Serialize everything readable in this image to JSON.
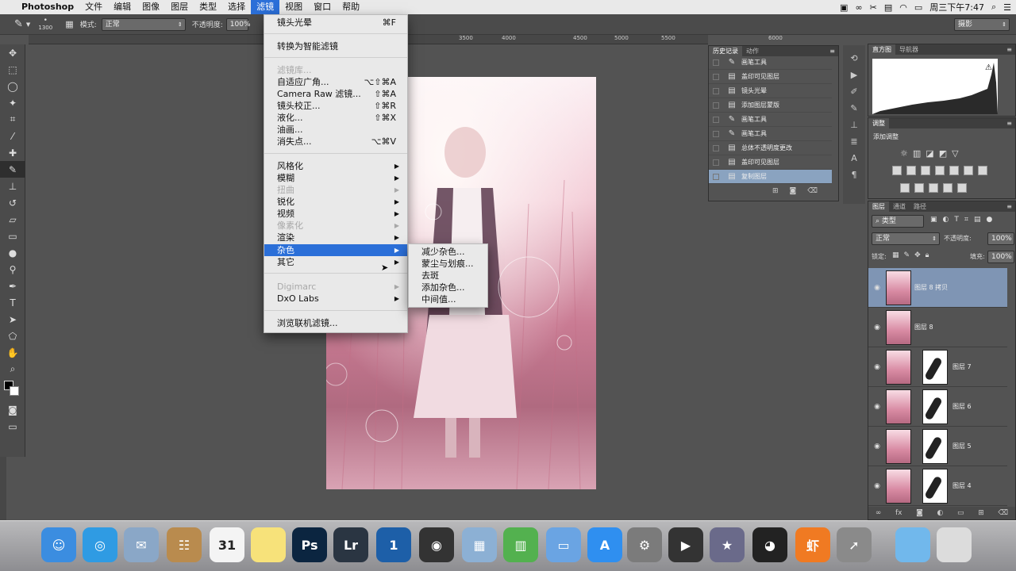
{
  "menubar": {
    "apple": "",
    "items": [
      "Photoshop",
      "文件",
      "编辑",
      "图像",
      "图层",
      "类型",
      "选择",
      "滤镜",
      "视图",
      "窗口",
      "帮助"
    ],
    "active_index": 7,
    "clock": "周三下午7:47"
  },
  "optbar": {
    "brush_size": "1300",
    "mode_label": "模式:",
    "mode_value": "正常",
    "opacity_label": "不透明度:",
    "opacity_value": "100%",
    "workspace": "摄影"
  },
  "ruler": {
    "ticks": [
      "3500",
      "4000",
      "4500",
      "5000",
      "5500",
      "6000"
    ]
  },
  "filter_menu": {
    "items": [
      {
        "label": "镜头光晕",
        "shortcut": "⌘F",
        "disabled": false,
        "submenu": false
      },
      {
        "label": "转换为智能滤镜",
        "shortcut": "",
        "disabled": false,
        "submenu": false
      },
      {
        "label": "滤镜库...",
        "shortcut": "",
        "disabled": true,
        "submenu": false
      },
      {
        "label": "自适应广角...",
        "shortcut": "⌥⇧⌘A",
        "disabled": false,
        "submenu": false
      },
      {
        "label": "Camera Raw 滤镜...",
        "shortcut": "⇧⌘A",
        "disabled": false,
        "submenu": false
      },
      {
        "label": "镜头校正...",
        "shortcut": "⇧⌘R",
        "disabled": false,
        "submenu": false
      },
      {
        "label": "液化...",
        "shortcut": "⇧⌘X",
        "disabled": false,
        "submenu": false
      },
      {
        "label": "油画...",
        "shortcut": "",
        "disabled": false,
        "submenu": false
      },
      {
        "label": "消失点...",
        "shortcut": "⌥⌘V",
        "disabled": false,
        "submenu": false
      },
      {
        "label": "风格化",
        "shortcut": "",
        "disabled": false,
        "submenu": true
      },
      {
        "label": "模糊",
        "shortcut": "",
        "disabled": false,
        "submenu": true
      },
      {
        "label": "扭曲",
        "shortcut": "",
        "disabled": true,
        "submenu": true
      },
      {
        "label": "锐化",
        "shortcut": "",
        "disabled": false,
        "submenu": true
      },
      {
        "label": "视频",
        "shortcut": "",
        "disabled": false,
        "submenu": true
      },
      {
        "label": "像素化",
        "shortcut": "",
        "disabled": true,
        "submenu": true
      },
      {
        "label": "渲染",
        "shortcut": "",
        "disabled": false,
        "submenu": true
      },
      {
        "label": "杂色",
        "shortcut": "",
        "disabled": false,
        "submenu": true,
        "selected": true
      },
      {
        "label": "其它",
        "shortcut": "",
        "disabled": false,
        "submenu": true
      },
      {
        "label": "Digimarc",
        "shortcut": "",
        "disabled": true,
        "submenu": true
      },
      {
        "label": "DxO Labs",
        "shortcut": "",
        "disabled": false,
        "submenu": true
      },
      {
        "label": "浏览联机滤镜...",
        "shortcut": "",
        "disabled": false,
        "submenu": false
      }
    ]
  },
  "noise_submenu": [
    "减少杂色...",
    "蒙尘与划痕...",
    "去斑",
    "添加杂色...",
    "中间值..."
  ],
  "history": {
    "tabs": [
      "历史记录",
      "动作"
    ],
    "items": [
      "画笔工具",
      "盖印可见图层",
      "镜头光晕",
      "添加图层蒙版",
      "画笔工具",
      "画笔工具",
      "总体不透明度更改",
      "盖印可见图层",
      "复制图层"
    ],
    "icons": [
      "brush",
      "doc",
      "doc",
      "doc",
      "brush",
      "brush",
      "doc",
      "doc",
      "doc"
    ]
  },
  "histogram": {
    "tabs": [
      "直方图",
      "导航器"
    ]
  },
  "adjustments": {
    "tab": "调整",
    "title": "添加调整"
  },
  "layers": {
    "tabs": [
      "图层",
      "通道",
      "路径"
    ],
    "filter": "类型",
    "blend": "正常",
    "opacity_label": "不透明度:",
    "opacity": "100%",
    "lock_label": "锁定:",
    "fill_label": "填充:",
    "fill": "100%",
    "items": [
      {
        "name": "图层 8 拷贝",
        "mask": false,
        "selected": true
      },
      {
        "name": "图层 8",
        "mask": false,
        "selected": false
      },
      {
        "name": "图层 7",
        "mask": true,
        "selected": false
      },
      {
        "name": "图层 6",
        "mask": true,
        "selected": false
      },
      {
        "name": "图层 5",
        "mask": true,
        "selected": false
      },
      {
        "name": "图层 4",
        "mask": true,
        "selected": false
      }
    ]
  },
  "dock": {
    "apps": [
      {
        "name": "finder",
        "label": "☺",
        "color": "#3b8de0"
      },
      {
        "name": "safari",
        "label": "◎",
        "color": "#2f9be3"
      },
      {
        "name": "mail",
        "label": "✉",
        "color": "#8aa7c7"
      },
      {
        "name": "contacts",
        "label": "☷",
        "color": "#b98b4e"
      },
      {
        "name": "calendar",
        "label": "31",
        "color": "#f4f4f4"
      },
      {
        "name": "notes",
        "label": "",
        "color": "#f7e27a"
      },
      {
        "name": "photoshop",
        "label": "Ps",
        "color": "#0b2540"
      },
      {
        "name": "lightroom",
        "label": "Lr",
        "color": "#2a3542"
      },
      {
        "name": "onepassword",
        "label": "1",
        "color": "#1d5fa8"
      },
      {
        "name": "capture",
        "label": "◉",
        "color": "#333"
      },
      {
        "name": "preview",
        "label": "▦",
        "color": "#8cb0d4"
      },
      {
        "name": "numbers",
        "label": "▥",
        "color": "#53b14f"
      },
      {
        "name": "keynote",
        "label": "▭",
        "color": "#6aa4e3"
      },
      {
        "name": "appstore",
        "label": "A",
        "color": "#2f8ff0"
      },
      {
        "name": "sysprefs",
        "label": "⚙",
        "color": "#7b7b7b"
      },
      {
        "name": "finalcut",
        "label": "▶",
        "color": "#333"
      },
      {
        "name": "imovie",
        "label": "★",
        "color": "#6a6a8a"
      },
      {
        "name": "qq",
        "label": "◕",
        "color": "#222"
      },
      {
        "name": "xiami",
        "label": "虾",
        "color": "#f07a22"
      },
      {
        "name": "launchpad",
        "label": "➚",
        "color": "#8a8a8a"
      },
      {
        "name": "folder",
        "label": "",
        "color": "#71b8ec"
      },
      {
        "name": "trash",
        "label": "",
        "color": "#dcdcdc"
      }
    ]
  }
}
